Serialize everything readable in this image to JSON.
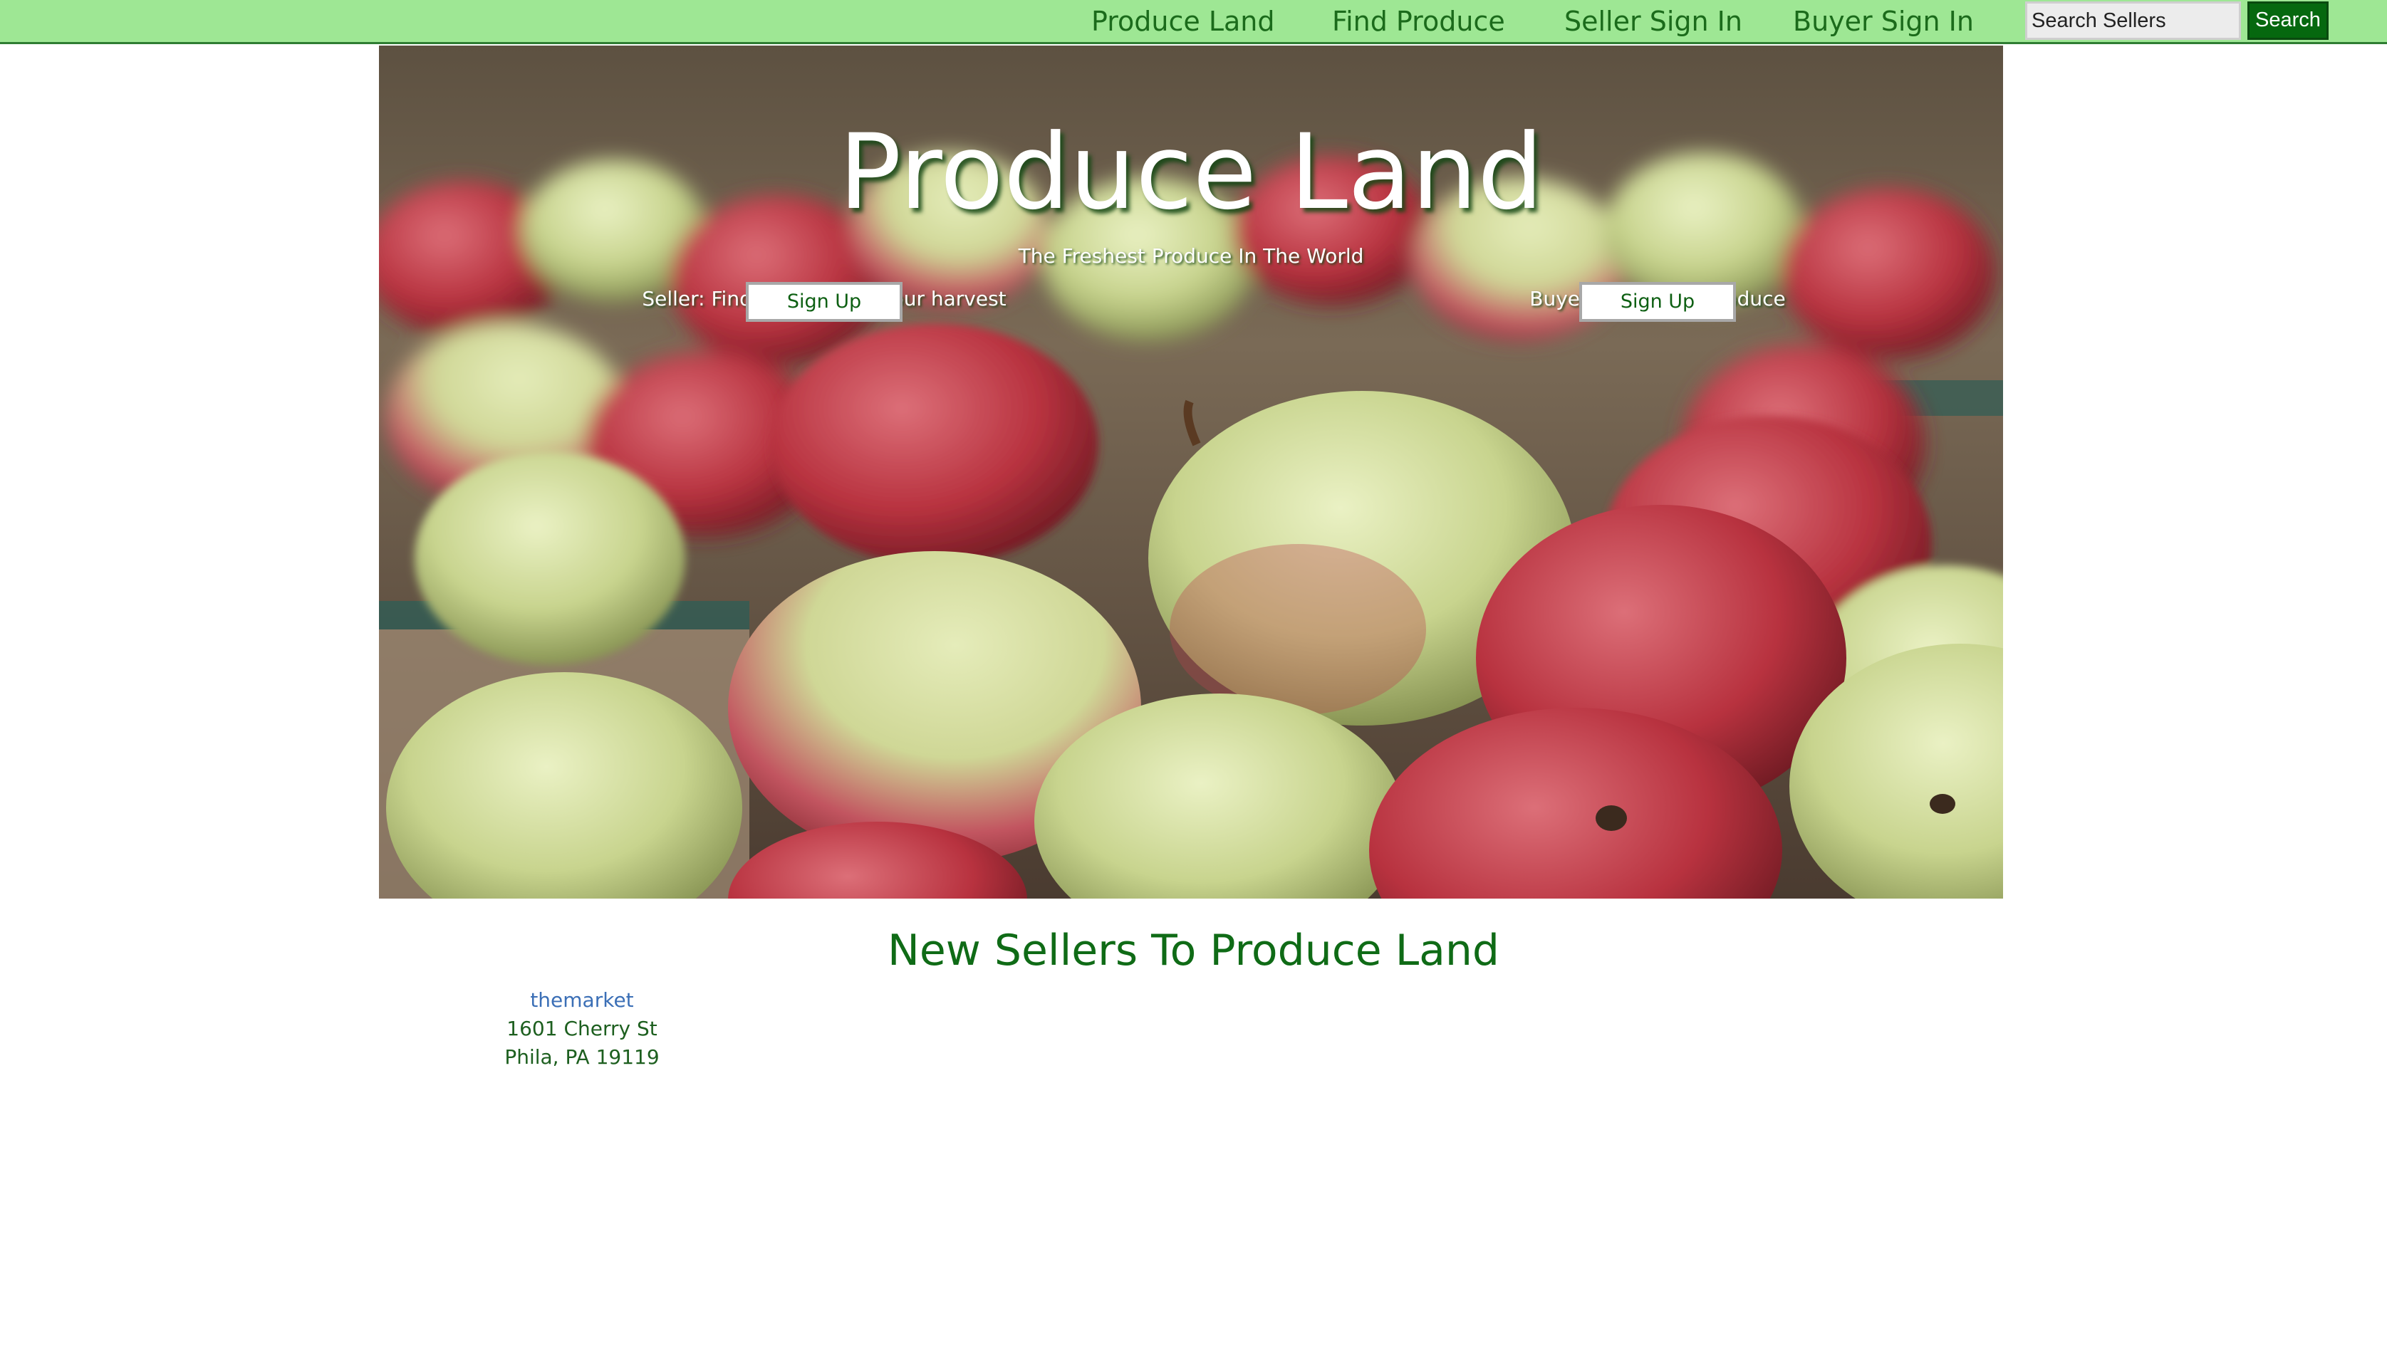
{
  "nav": {
    "items": [
      {
        "label": "Produce Land"
      },
      {
        "label": "Find Produce"
      },
      {
        "label": "Seller Sign In"
      },
      {
        "label": "Buyer Sign In"
      }
    ],
    "search_placeholder": "Search Sellers",
    "search_button": "Search"
  },
  "hero": {
    "title": "Produce Land",
    "subtitle": "The Freshest Produce In The World",
    "seller": {
      "text": "Seller: Find markets for your harvest",
      "button": "Sign Up"
    },
    "buyer": {
      "text": "Buyer: Find fresh produce",
      "button": "Sign Up"
    },
    "image": "apples-photo"
  },
  "new_sellers": {
    "title": "New Sellers To Produce Land",
    "sellers": [
      {
        "name": "themarket",
        "address1": "1601 Cherry St",
        "address2": "Phila, PA 19119"
      }
    ]
  },
  "colors": {
    "nav_bg": "#9ee794",
    "nav_text": "#1b6b1b",
    "search_button_bg": "#06680f",
    "heading": "#0f6b16",
    "link": "#3b6fb6"
  }
}
